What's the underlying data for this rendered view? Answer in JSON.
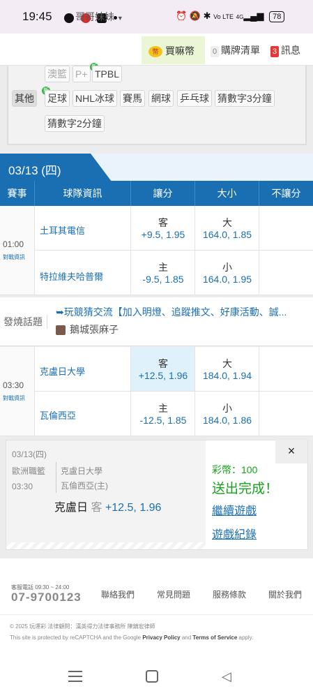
{
  "status_bar": {
    "time": "19:45",
    "battery": "78",
    "network": "4G"
  },
  "topbar": {
    "sibling": "哥哥妹妹",
    "buy_coins": "買嘛幣",
    "purchase_list_count": "0",
    "purchase_list": "購牌清單",
    "message_count": "3",
    "messages": "訊息"
  },
  "sports_panel": {
    "row1": [
      "澳籃",
      "P+",
      "TPBL"
    ],
    "other_label": "其他",
    "row2": [
      "足球",
      "NHL冰球",
      "賽馬",
      "網球",
      "乒乓球",
      "猜數字3分鐘"
    ],
    "row3": [
      "猜數字2分鐘"
    ]
  },
  "date_tab": "03/13 (四)",
  "table_headers": [
    "賽事",
    "球隊資訊",
    "讓分",
    "大小",
    "不讓分"
  ],
  "games": [
    {
      "time": "01:00",
      "info_link": "對戰資訊",
      "away_team": "土耳其電信",
      "home_team": "特拉維夫哈普爾",
      "away_spread_label": "客",
      "away_spread": "+9.5, 1.95",
      "home_spread_label": "主",
      "home_spread": "-9.5, 1.85",
      "over_label": "大",
      "over": "164.0, 1.85",
      "under_label": "小",
      "under": "164.0, 1.95"
    },
    {
      "time": "03:30",
      "info_link": "對戰資訊",
      "away_team": "克盧日大學",
      "home_team": "瓦倫西亞",
      "away_spread_label": "客",
      "away_spread": "+12.5, 1.96",
      "home_spread_label": "主",
      "home_spread": "-12.5, 1.85",
      "over_label": "大",
      "over": "184.0, 1.94",
      "under_label": "小",
      "under": "184.0, 1.86"
    }
  ],
  "hot_topic": {
    "label": "發燒話題",
    "link": "➥玩競猜交流【加入明燈、追蹤推文、好康活動、誠...",
    "user": "鵝城張麻子"
  },
  "bet_slip": {
    "date": "03/13(四)",
    "league": "歐洲職籃",
    "time": "03:30",
    "team1": "克盧日大學",
    "team2": "瓦倫西亞(主)",
    "pick_team": "克盧日",
    "pick_side": "客",
    "pick_odds": "+12.5, 1.96",
    "coins": "彩幣：100",
    "status": "送出完成！",
    "continue": "繼續遊戲",
    "history": "遊戲紀錄",
    "close": "×"
  },
  "footer": {
    "phone_label": "客服電話 09:30 ~ 24:00",
    "phone": "07-9700123",
    "links": [
      "聯絡我們",
      "常見問題",
      "服務條款",
      "關於我們"
    ],
    "copyright": "© 2025 玩運彩 法律顧問：漢英得力法律事務所 陳鎮宏律師",
    "recaptcha_pre": "This site is protected by reCAPTCHA and the Google",
    "privacy": "Privacy Policy",
    "and": "and",
    "terms": "Terms of Service",
    "apply": "apply."
  },
  "colors": {
    "primary": "#1a6fb3",
    "selected": "#dff1fb",
    "success": "#16a31c",
    "alert": "#e53935"
  }
}
